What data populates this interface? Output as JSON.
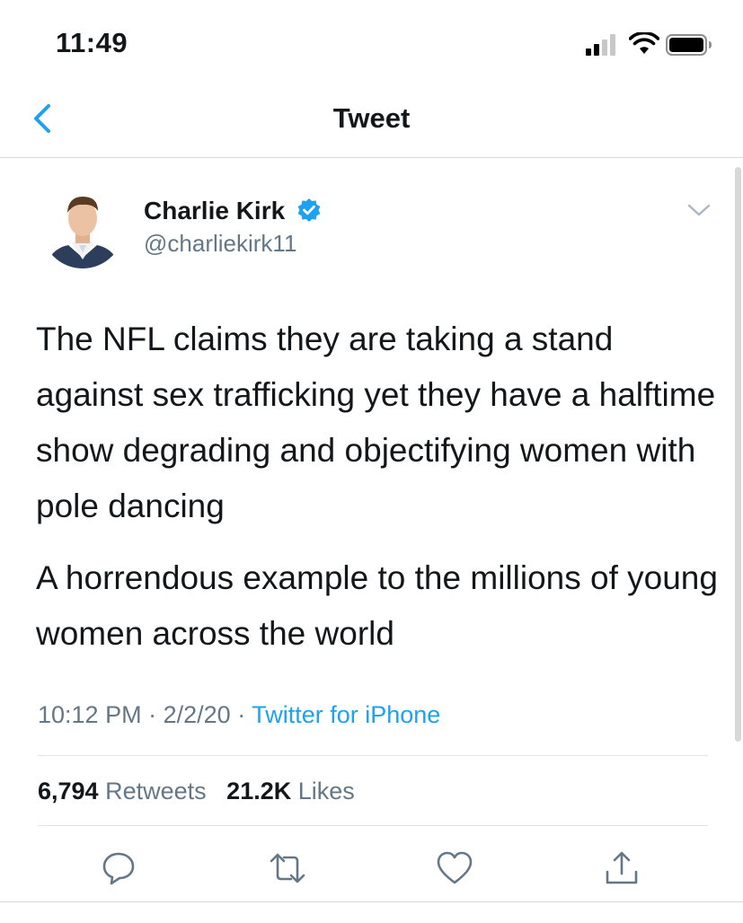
{
  "status_bar": {
    "time": "11:49",
    "icons": [
      "signal-icon",
      "wifi-icon",
      "battery-icon"
    ]
  },
  "nav": {
    "title": "Tweet",
    "back_icon": "chevron-left-icon"
  },
  "tweet": {
    "author": {
      "name": "Charlie Kirk",
      "handle": "@charliekirk11",
      "verified": true
    },
    "paragraphs": [
      "The NFL claims they are taking a stand against sex trafficking yet they have a halftime show degrading and objectifying women with pole dancing",
      "A horrendous example to the millions of young women across the world"
    ],
    "time": "10:12 PM",
    "date": "2/2/20",
    "separator": "·",
    "source": "Twitter for iPhone",
    "stats": {
      "retweets_count": "6,794",
      "retweets_label": "Retweets",
      "likes_count": "21.2K",
      "likes_label": "Likes"
    },
    "actions": [
      "reply-icon",
      "retweet-icon",
      "like-icon",
      "share-icon"
    ]
  },
  "colors": {
    "link": "#1da1f2",
    "secondary_text": "#657786",
    "primary_text": "#14171a",
    "verified": "#1da1f2"
  }
}
